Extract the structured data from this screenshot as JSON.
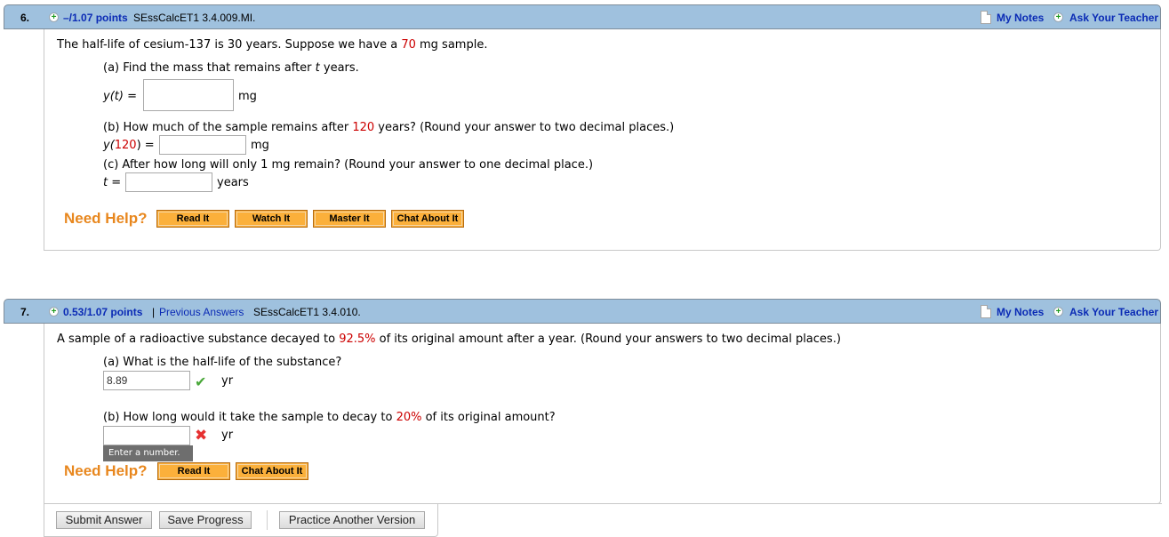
{
  "questions": [
    {
      "number": "6.",
      "points": "–/1.07 points",
      "id": "SEssCalcET1 3.4.009.MI.",
      "my_notes": "My Notes",
      "ask_teacher": "Ask Your Teacher",
      "intro": {
        "pre": "The half-life of cesium-137 is 30 years. Suppose we have a ",
        "highlight": "70",
        "post": " mg sample."
      },
      "part_a": {
        "prompt_pre": "(a) Find the mass that remains after ",
        "prompt_var": "t",
        "prompt_post": " years.",
        "label": "y(t) =",
        "value": "",
        "unit": "mg"
      },
      "part_b": {
        "prompt_pre": "(b) How much of the sample remains after ",
        "prompt_highlight": "120",
        "prompt_post": " years? (Round your answer to two decimal places.)",
        "label_pre": "y(",
        "label_highlight": "120",
        "label_post": ") =",
        "value": "",
        "unit": "mg"
      },
      "part_c": {
        "prompt": "(c) After how long will only 1 mg remain? (Round your answer to one decimal place.)",
        "label": "t =",
        "value": "",
        "unit": "years"
      },
      "need_help": "Need Help?",
      "help_buttons": [
        "Read It",
        "Watch It",
        "Master It",
        "Chat About It"
      ]
    },
    {
      "number": "7.",
      "points": "0.53/1.07 points",
      "separator": "|",
      "previous_answers": "Previous Answers",
      "id": "SEssCalcET1 3.4.010.",
      "my_notes": "My Notes",
      "ask_teacher": "Ask Your Teacher",
      "intro": {
        "pre": "A sample of a radioactive substance decayed to ",
        "highlight": "92.5%",
        "post": " of its original amount after a year. (Round your answers to two decimal places.)"
      },
      "part_a": {
        "prompt": "(a) What is the half-life of the substance?",
        "value": "8.89",
        "status": "correct",
        "unit": "yr"
      },
      "part_b": {
        "prompt_pre": "(b) How long would it take the sample to decay to ",
        "prompt_highlight": "20%",
        "prompt_post": " of its original amount?",
        "value": "",
        "status": "incorrect",
        "unit": "yr",
        "tooltip": "Enter a number."
      },
      "need_help": "Need Help?",
      "help_buttons": [
        "Read It",
        "Chat About It"
      ]
    }
  ],
  "actions": {
    "submit": "Submit Answer",
    "save": "Save Progress",
    "practice": "Practice Another Version"
  },
  "colors": {
    "header_bg": "#9fc1de",
    "link": "#0b2bb5",
    "highlight": "#cc0000",
    "need_help": "#e8871e",
    "help_button": "#fbb03b"
  }
}
